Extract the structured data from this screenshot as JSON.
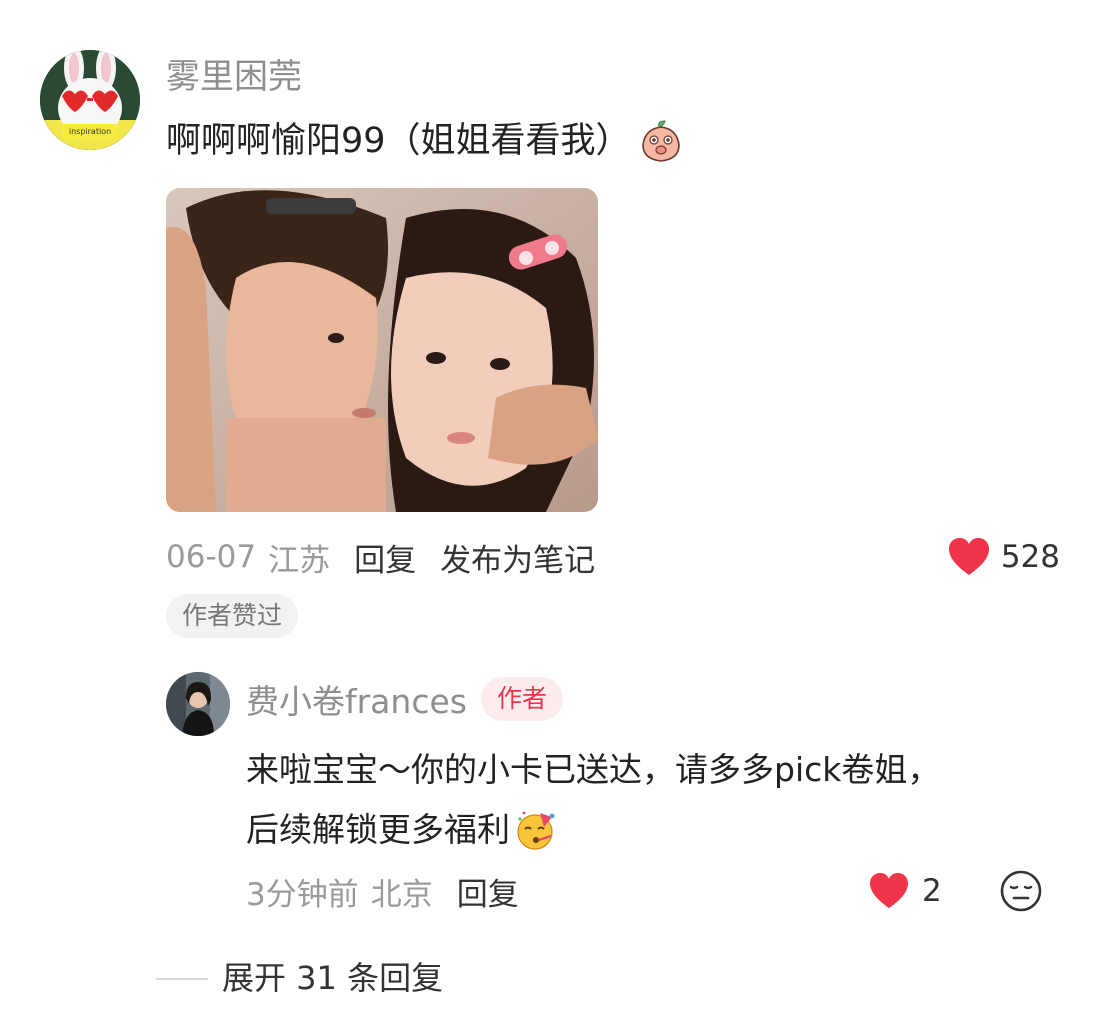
{
  "comment": {
    "username": "雾里困莞",
    "text": "啊啊啊愉阳99（姐姐看看我）",
    "emoji": "peach-emoji",
    "date": "06-07",
    "location": "江苏",
    "reply_label": "回复",
    "publish_label": "发布为笔记",
    "likes": "528",
    "author_liked_label": "作者赞过",
    "avatar_text": "inspiration"
  },
  "reply": {
    "username": "费小卷frances",
    "author_badge": "作者",
    "text_line1": "来啦宝宝～你的小卡已送达，请多多pick卷姐，",
    "text_line2": "后续解锁更多福利",
    "emoji": "party-face-emoji",
    "time": "3分钟前",
    "location": "北京",
    "reply_label": "回复",
    "likes": "2"
  },
  "expand": {
    "label": "展开 31 条回复"
  },
  "colors": {
    "heart": "#f0344a",
    "badge_bg": "#fdecee",
    "badge_text": "#e8374c",
    "meta_gray": "#9a9a9a",
    "name_gray": "#8e8e8e"
  }
}
